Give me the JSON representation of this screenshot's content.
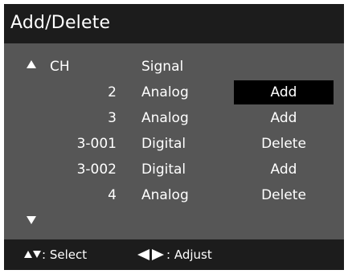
{
  "title": "Add/Delete",
  "header": {
    "ch": "CH",
    "signal": "Signal"
  },
  "rows": [
    {
      "ch": "2",
      "signal": "Analog",
      "action": "Add",
      "selected": true
    },
    {
      "ch": "3",
      "signal": "Analog",
      "action": "Add",
      "selected": false
    },
    {
      "ch": "3-001",
      "signal": "Digital",
      "action": "Delete",
      "selected": false
    },
    {
      "ch": "3-002",
      "signal": "Digital",
      "action": "Add",
      "selected": false
    },
    {
      "ch": "4",
      "signal": "Analog",
      "action": "Delete",
      "selected": false
    }
  ],
  "footer": {
    "select_label": ": Select",
    "adjust_label": ": Adjust"
  },
  "colors": {
    "title_bg": "#1c1c1c",
    "content_bg": "#565656",
    "selected_bg": "#000000",
    "text": "#ffffff"
  },
  "icons": [
    "scroll-up-arrow-icon",
    "scroll-down-arrow-icon",
    "up-down-arrows-icon",
    "left-right-arrows-icon"
  ]
}
